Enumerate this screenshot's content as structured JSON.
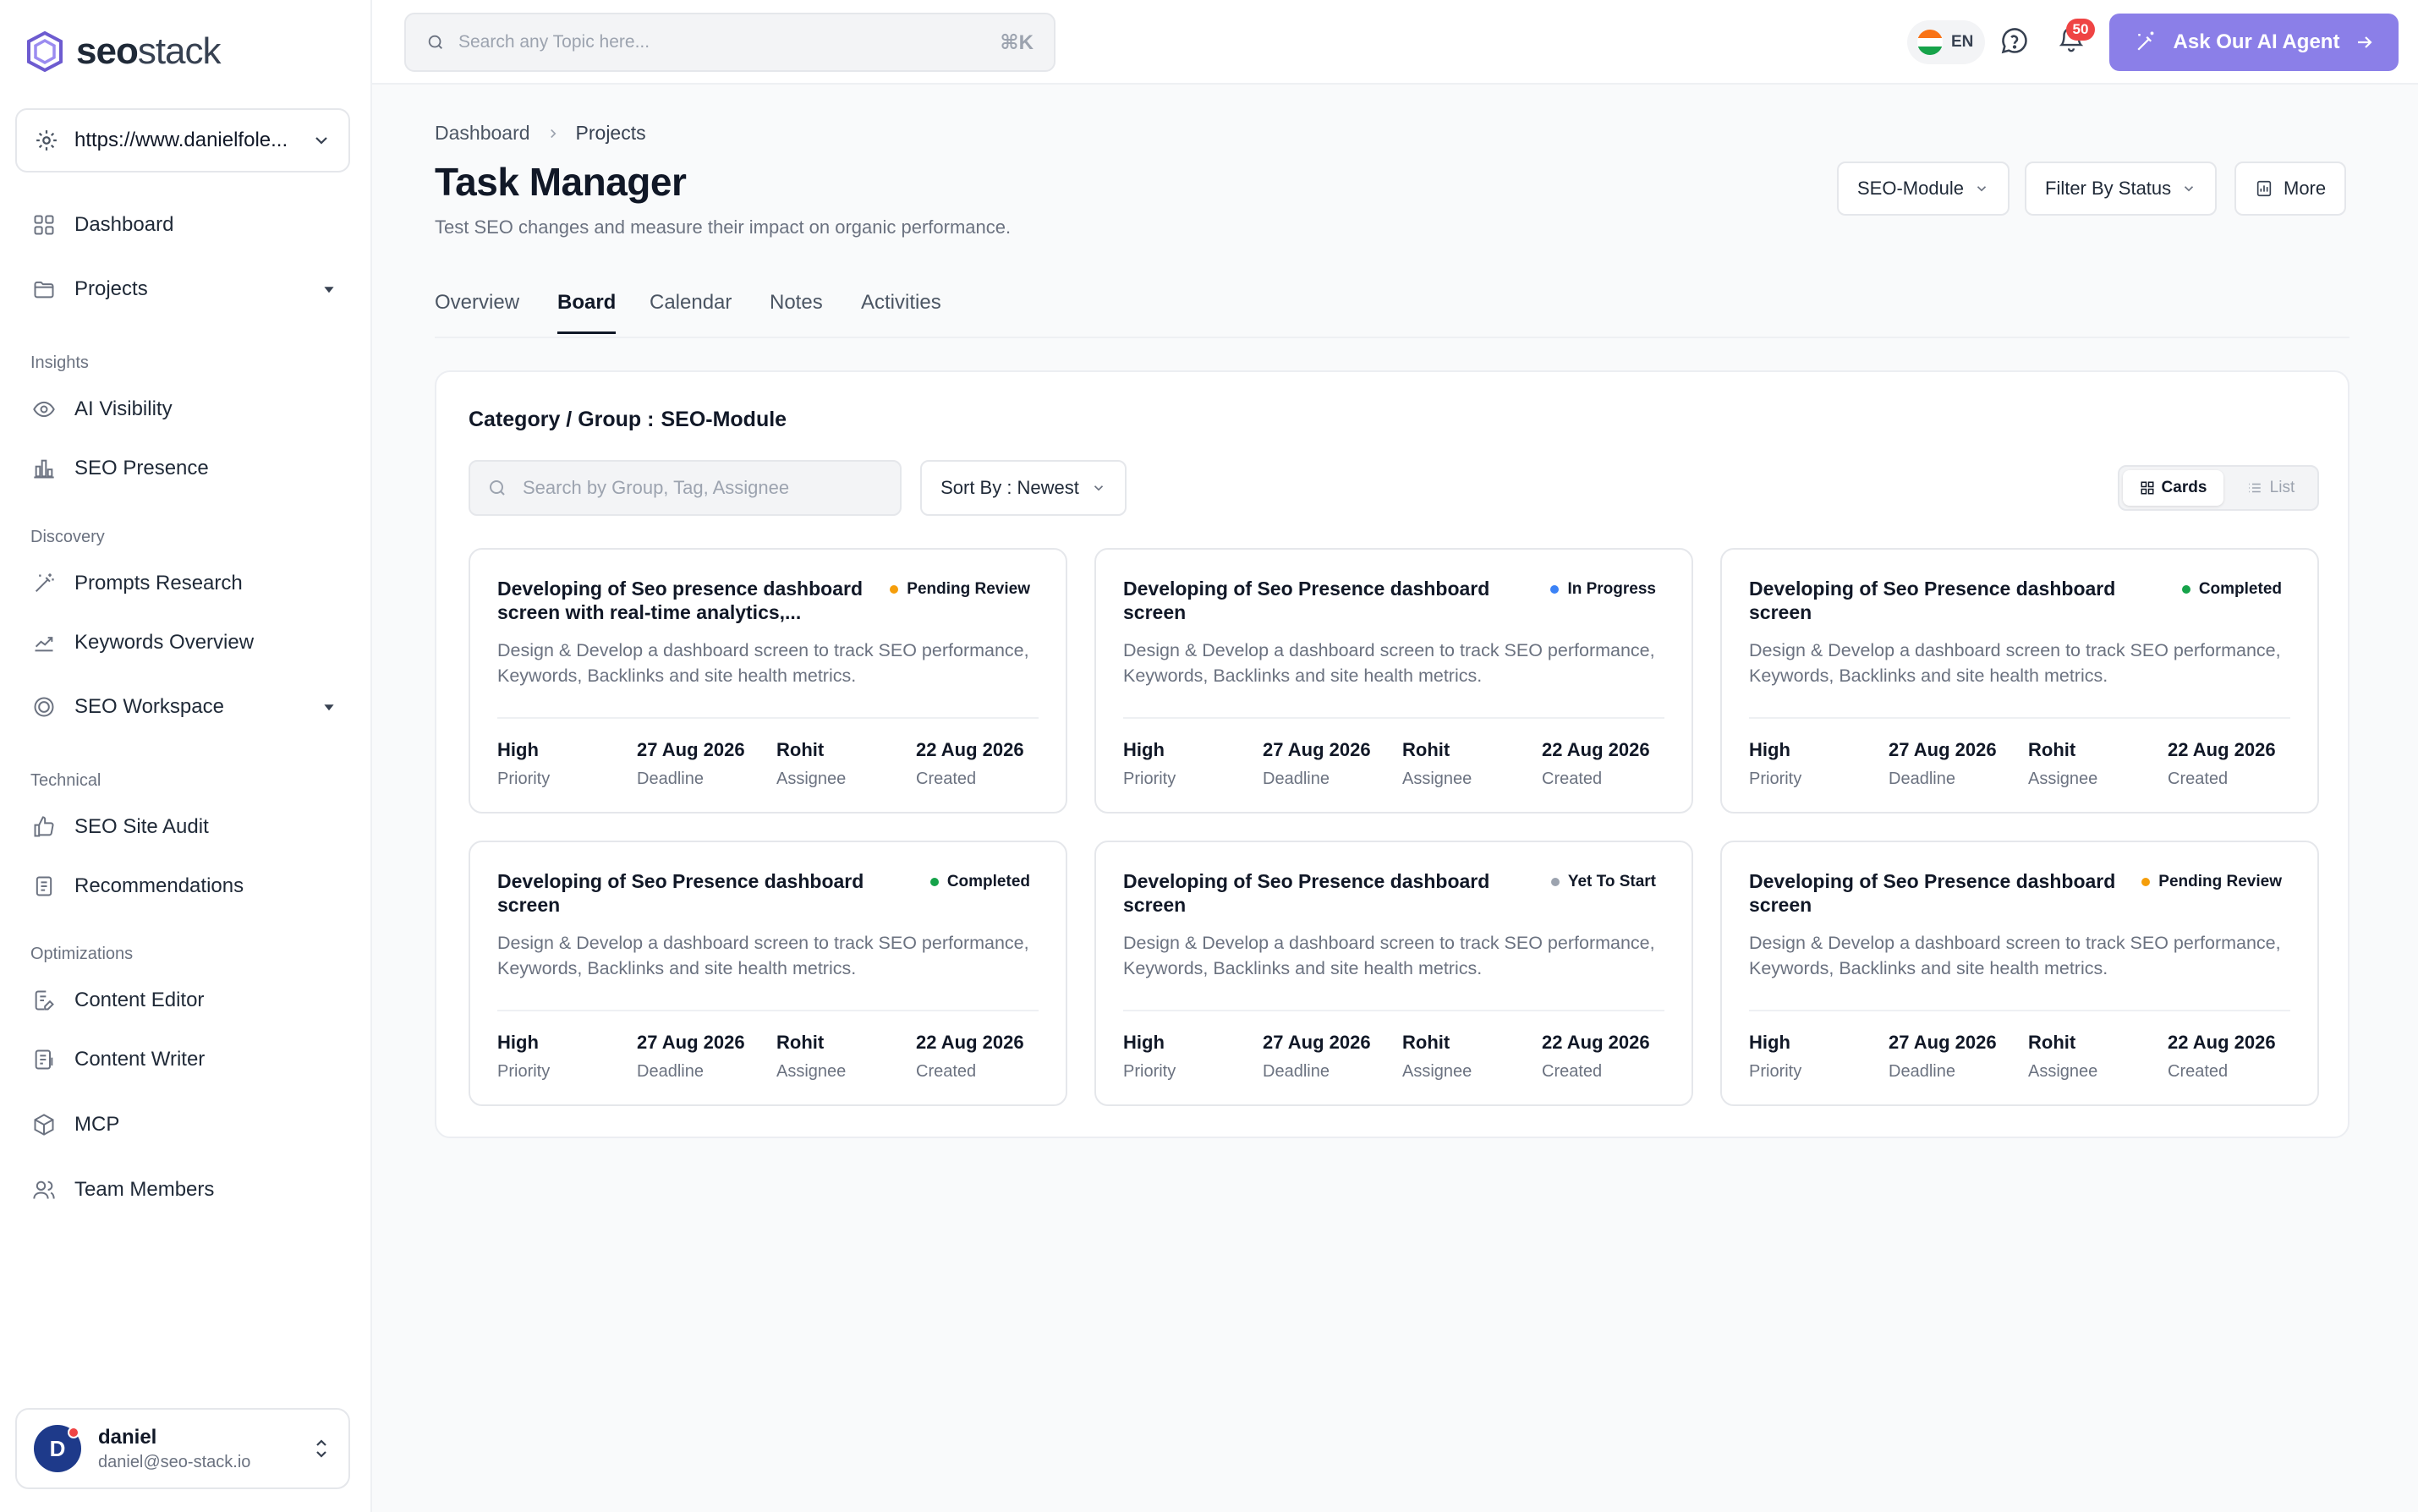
{
  "brand": {
    "name_bold": "seo",
    "name_light": "stack"
  },
  "site_selector": {
    "value": "https://www.danielfole..."
  },
  "nav": {
    "main": [
      {
        "label": "Dashboard",
        "icon": "grid-icon"
      },
      {
        "label": "Projects",
        "icon": "folder-icon"
      }
    ],
    "sections": [
      {
        "title": "Insights",
        "items": [
          {
            "label": "AI Visibility",
            "icon": "eye-icon"
          },
          {
            "label": "SEO Presence",
            "icon": "bar-chart-icon"
          }
        ]
      },
      {
        "title": "Discovery",
        "items": [
          {
            "label": "Prompts Research",
            "icon": "magic-wand-icon"
          },
          {
            "label": "Keywords Overview",
            "icon": "trend-chart-icon"
          },
          {
            "label": "SEO Workspace",
            "icon": "target-icon"
          }
        ]
      },
      {
        "title": "Technical",
        "items": [
          {
            "label": "SEO Site Audit",
            "icon": "thumbs-up-icon"
          },
          {
            "label": "Recommendations",
            "icon": "document-list-icon"
          }
        ]
      },
      {
        "title": "Optimizations",
        "items": [
          {
            "label": "Content Editor",
            "icon": "edit-document-icon"
          },
          {
            "label": "Content Writer",
            "icon": "write-document-icon"
          },
          {
            "label": "MCP",
            "icon": "cube-icon"
          },
          {
            "label": "Team Members",
            "icon": "users-icon"
          }
        ]
      }
    ]
  },
  "user": {
    "initial": "D",
    "name": "daniel",
    "email": "daniel@seo-stack.io"
  },
  "topbar": {
    "search_placeholder": "Search any Topic here...",
    "shortcut": "⌘K",
    "language": "EN",
    "notification_count": "50",
    "ai_button": "Ask Our AI Agent"
  },
  "breadcrumb": {
    "root": "Dashboard",
    "current": "Projects"
  },
  "page": {
    "title": "Task Manager",
    "subtitle": "Test SEO changes and measure their impact on organic performance.",
    "buttons": {
      "module": "SEO-Module",
      "filter": "Filter By Status",
      "more": "More"
    }
  },
  "tabs": [
    "Overview",
    "Board",
    "Calendar",
    "Notes",
    "Activities"
  ],
  "active_tab": "Board",
  "board": {
    "category_label": "Category / Group :",
    "category_value": "SEO-Module",
    "search_placeholder": "Search by Group, Tag, Assignee",
    "sort_label": "Sort By : Newest",
    "view": {
      "cards": "Cards",
      "list": "List"
    },
    "meta_labels": {
      "priority": "Priority",
      "deadline": "Deadline",
      "assignee": "Assignee",
      "created": "Created"
    },
    "cards": [
      {
        "title": "Developing of Seo presence dashboard screen with real-time analytics,...",
        "status": "Pending Review",
        "status_color": "#f59e0b",
        "desc": "Design & Develop a dashboard screen to track SEO performance, Keywords, Backlinks and site health metrics.",
        "priority": "High",
        "deadline": "27 Aug 2026",
        "assignee": "Rohit",
        "created": "22 Aug 2026"
      },
      {
        "title": "Developing of Seo Presence dashboard screen",
        "status": "In Progress",
        "status_color": "#3b82f6",
        "desc": "Design & Develop a dashboard screen to track SEO performance, Keywords, Backlinks and site health metrics.",
        "priority": "High",
        "deadline": "27 Aug 2026",
        "assignee": "Rohit",
        "created": "22 Aug 2026"
      },
      {
        "title": "Developing of Seo Presence dashboard screen",
        "status": "Completed",
        "status_color": "#16a34a",
        "desc": "Design & Develop a dashboard screen to track SEO performance, Keywords, Backlinks and site health metrics.",
        "priority": "High",
        "deadline": "27 Aug 2026",
        "assignee": "Rohit",
        "created": "22 Aug 2026"
      },
      {
        "title": "Developing of Seo Presence dashboard screen",
        "status": "Completed",
        "status_color": "#16a34a",
        "desc": "Design & Develop a dashboard screen to track SEO performance, Keywords, Backlinks and site health metrics.",
        "priority": "High",
        "deadline": "27 Aug 2026",
        "assignee": "Rohit",
        "created": "22 Aug 2026"
      },
      {
        "title": "Developing of Seo Presence dashboard screen",
        "status": "Yet To Start",
        "status_color": "#9ca3af",
        "desc": "Design & Develop a dashboard screen to track SEO performance, Keywords, Backlinks and site health metrics.",
        "priority": "High",
        "deadline": "27 Aug 2026",
        "assignee": "Rohit",
        "created": "22 Aug 2026"
      },
      {
        "title": "Developing of Seo Presence dashboard screen",
        "status": "Pending Review",
        "status_color": "#f59e0b",
        "desc": "Design & Develop a dashboard screen to track SEO performance, Keywords, Backlinks and site health metrics.",
        "priority": "High",
        "deadline": "27 Aug 2026",
        "assignee": "Rohit",
        "created": "22 Aug 2026"
      }
    ]
  },
  "colors": {
    "accent": "#8b7fe8",
    "notification": "#ef4444",
    "avatar": "#1e3a8a"
  }
}
